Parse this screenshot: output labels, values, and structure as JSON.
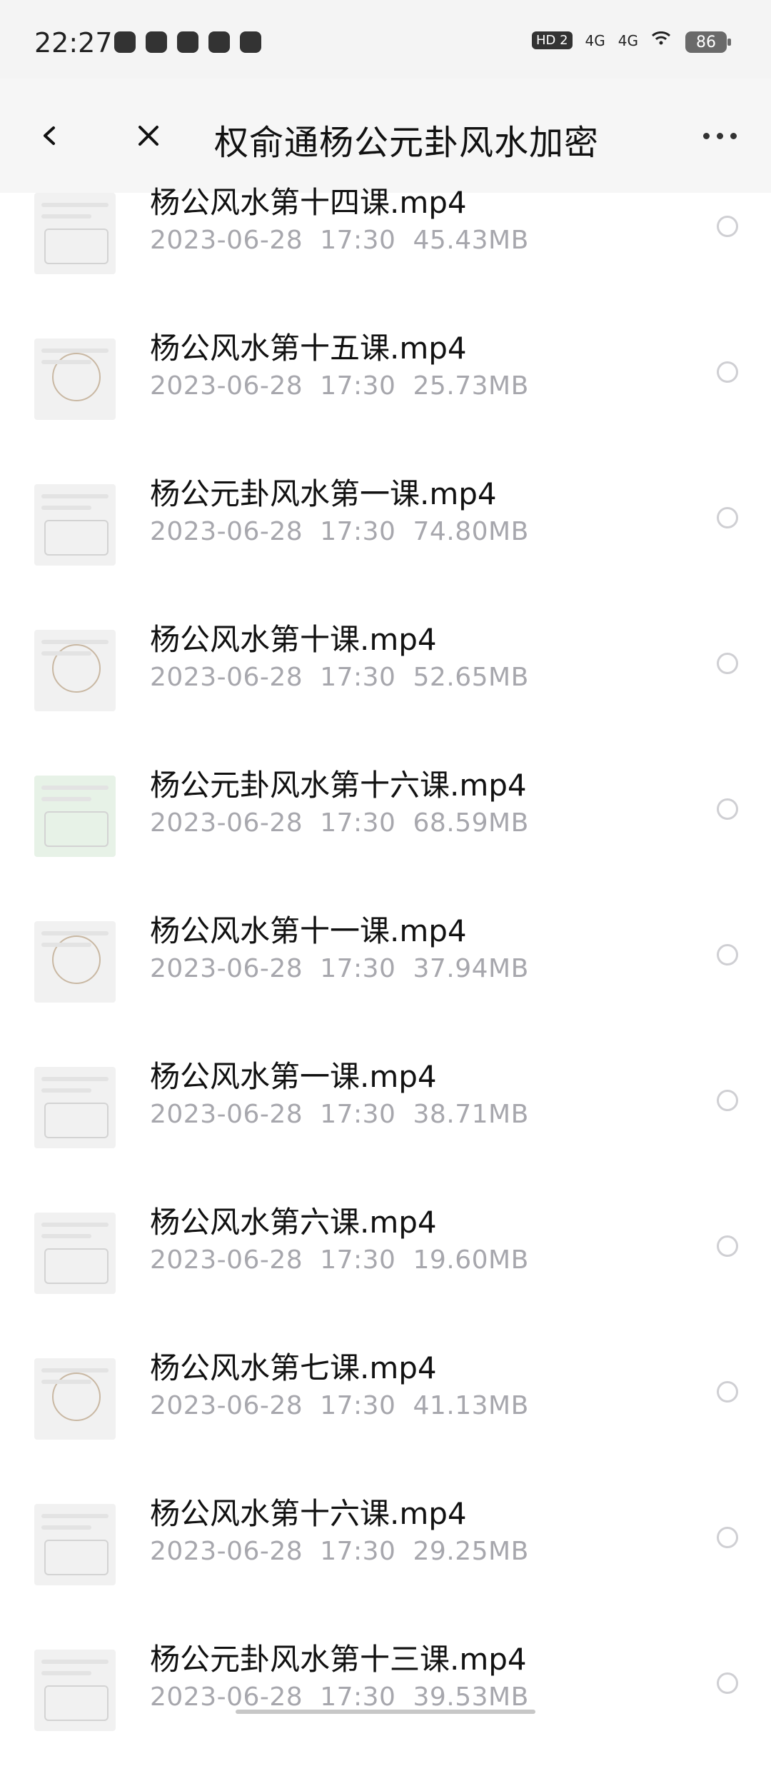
{
  "status_bar": {
    "time": "22:27",
    "signal_labels": [
      "HD 2",
      "4G",
      "4G"
    ],
    "battery": "86"
  },
  "header": {
    "title": "权俞通杨公元卦风水加密",
    "back_icon": "chevron-left-icon",
    "close_icon": "close-icon",
    "more_icon": "more-horizontal-icon"
  },
  "files": [
    {
      "name": "杨公风水第十四课.mp4",
      "date": "2023-06-28",
      "time": "17:30",
      "size": "45.43MB"
    },
    {
      "name": "杨公风水第十五课.mp4",
      "date": "2023-06-28",
      "time": "17:30",
      "size": "25.73MB"
    },
    {
      "name": "杨公元卦风水第一课.mp4",
      "date": "2023-06-28",
      "time": "17:30",
      "size": "74.80MB"
    },
    {
      "name": "杨公风水第十课.mp4",
      "date": "2023-06-28",
      "time": "17:30",
      "size": "52.65MB"
    },
    {
      "name": "杨公元卦风水第十六课.mp4",
      "date": "2023-06-28",
      "time": "17:30",
      "size": "68.59MB"
    },
    {
      "name": "杨公风水第十一课.mp4",
      "date": "2023-06-28",
      "time": "17:30",
      "size": "37.94MB"
    },
    {
      "name": "杨公风水第一课.mp4",
      "date": "2023-06-28",
      "time": "17:30",
      "size": "38.71MB"
    },
    {
      "name": "杨公风水第六课.mp4",
      "date": "2023-06-28",
      "time": "17:30",
      "size": "19.60MB"
    },
    {
      "name": "杨公风水第七课.mp4",
      "date": "2023-06-28",
      "time": "17:30",
      "size": "41.13MB"
    },
    {
      "name": "杨公风水第十六课.mp4",
      "date": "2023-06-28",
      "time": "17:30",
      "size": "29.25MB"
    },
    {
      "name": "杨公元卦风水第十三课.mp4",
      "date": "2023-06-28",
      "time": "17:30",
      "size": "39.53MB"
    }
  ]
}
